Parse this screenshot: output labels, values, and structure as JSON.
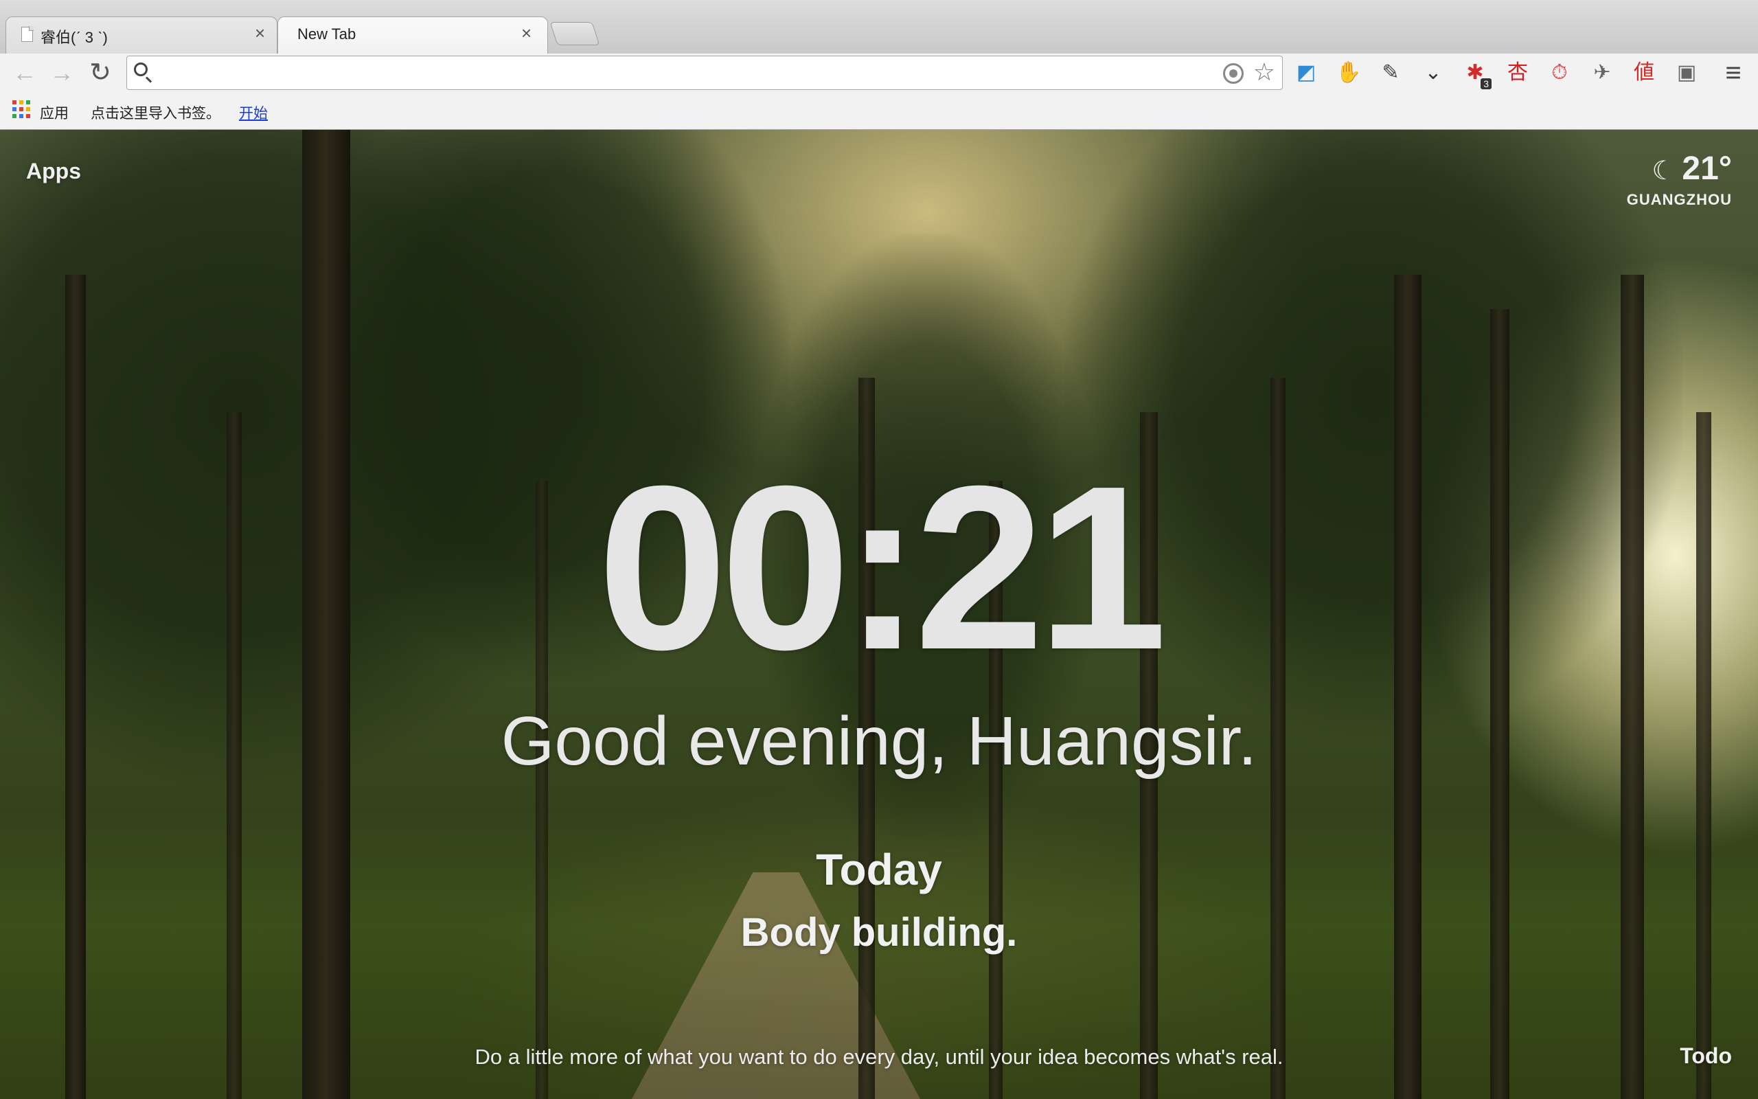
{
  "browser": {
    "tabs": [
      {
        "title": "睿伯(ˊ 3 ˋ)",
        "close": "×"
      },
      {
        "title": "New Tab",
        "close": "×"
      }
    ],
    "toolbar": {
      "back_icon": "←",
      "forward_icon": "→",
      "reload_icon": "↻",
      "omnibox_value": "",
      "extensions": [
        {
          "name": "dropbox-like-icon",
          "glyph": "◩",
          "color": "#2f8bd6"
        },
        {
          "name": "evernote-icon",
          "glyph": "✋",
          "color": "#444444"
        },
        {
          "name": "clip-icon",
          "glyph": "✎",
          "color": "#444444"
        },
        {
          "name": "pocket-icon",
          "glyph": "⌄",
          "color": "#333333"
        },
        {
          "name": "red-extension-icon",
          "glyph": "✱",
          "color": "#d32b2b",
          "badge": "3"
        },
        {
          "name": "chinese-extension-icon",
          "glyph": "杏",
          "color": "#cc2222"
        },
        {
          "name": "timer-icon",
          "glyph": "⏱",
          "color": "#e04040"
        },
        {
          "name": "bug-icon",
          "glyph": "✈",
          "color": "#666666"
        },
        {
          "name": "zhi-icon",
          "glyph": "値",
          "color": "#d22a2a"
        },
        {
          "name": "camera-icon",
          "glyph": "▣",
          "color": "#666666"
        }
      ],
      "menu_icon": "≡"
    },
    "bookmarks": {
      "apps_label": "应用",
      "import_text": "点击这里导入书签。",
      "start_link": "开始"
    }
  },
  "momentum": {
    "apps_link": "Apps",
    "weather": {
      "icon": "moon-icon",
      "moon_glyph": "☾",
      "temperature": "21°",
      "location": "GUANGZHOU"
    },
    "clock": "00:21",
    "greeting": "Good evening, Huangsir.",
    "focus_label": "Today",
    "focus_task": "Body building.",
    "quote": "Do a little more of what you want to do every day, until your idea becomes what's real.",
    "todo_label": "Todo"
  }
}
